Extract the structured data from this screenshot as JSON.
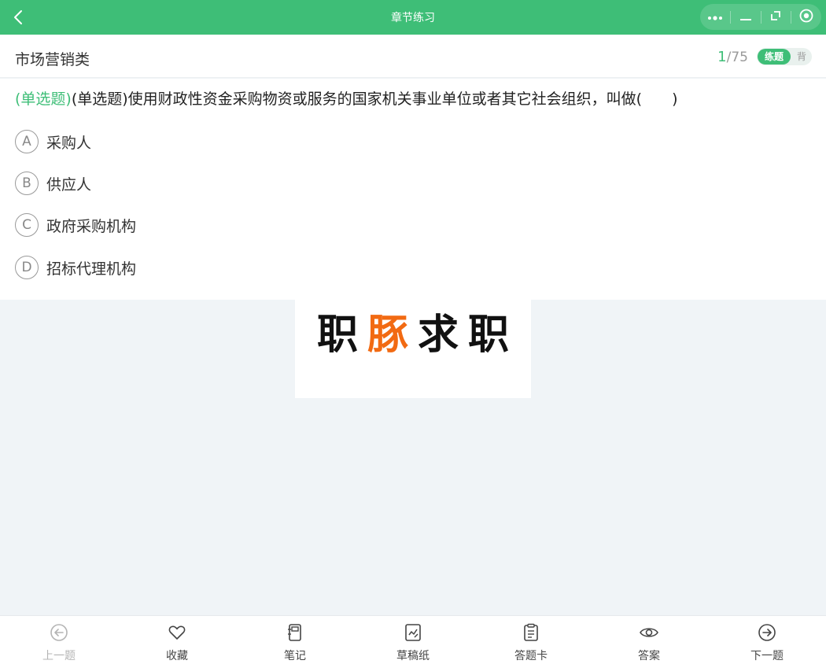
{
  "topbar": {
    "title": "章节练习",
    "back_icon": "chevron-left-icon",
    "capsule_icons": [
      "more-dots-icon",
      "minimize-icon",
      "restore-icon",
      "close-target-icon"
    ]
  },
  "header": {
    "category": "市场营销类",
    "progress": {
      "current": "1",
      "separator": "/",
      "total": "75"
    },
    "mode_practice": "练题",
    "mode_recite": "背"
  },
  "question": {
    "type_tag": "(单选题)",
    "text": "(单选题)使用财政性资金采购物资或服务的国家机关事业单位或者其它社会组织，叫做(　　)",
    "options": [
      {
        "letter": "A",
        "text": "采购人"
      },
      {
        "letter": "B",
        "text": "供应人"
      },
      {
        "letter": "C",
        "text": "政府采购机构"
      },
      {
        "letter": "D",
        "text": "招标代理机构"
      }
    ]
  },
  "watermark": {
    "chars": [
      "职",
      "豚",
      "求",
      "职"
    ],
    "accent_color": "#f26a12"
  },
  "bottom_nav": [
    {
      "label": "上一题",
      "icon": "arrow-left-circle-icon",
      "disabled": true
    },
    {
      "label": "收藏",
      "icon": "heart-icon",
      "disabled": false
    },
    {
      "label": "笔记",
      "icon": "notebook-icon",
      "disabled": false
    },
    {
      "label": "草稿纸",
      "icon": "draft-paper-icon",
      "disabled": false
    },
    {
      "label": "答题卡",
      "icon": "clipboard-icon",
      "disabled": false
    },
    {
      "label": "答案",
      "icon": "eye-icon",
      "disabled": false
    },
    {
      "label": "下一题",
      "icon": "arrow-right-circle-icon",
      "disabled": false
    }
  ],
  "colors": {
    "brand_green": "#3ebe77",
    "page_bg": "#f0f4f7",
    "accent_orange": "#f26a12"
  }
}
